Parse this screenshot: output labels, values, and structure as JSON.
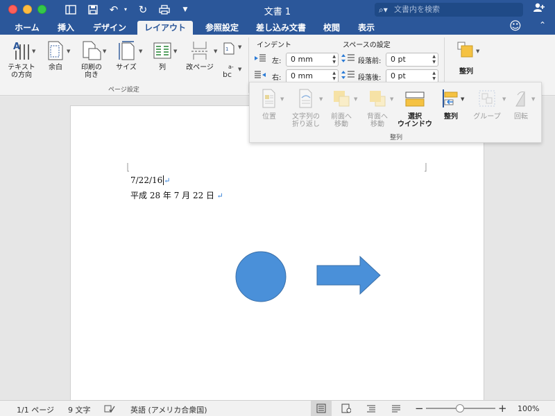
{
  "window": {
    "title": "文書 1"
  },
  "search": {
    "placeholder": "文書内を検索"
  },
  "tabs": [
    "ホーム",
    "挿入",
    "デザイン",
    "レイアウト",
    "参照設定",
    "差し込み文書",
    "校閲",
    "表示"
  ],
  "active_tab": "レイアウト",
  "ribbon": {
    "text_direction": "テキスト\nの方向",
    "margins": "余白",
    "orientation": "印刷の\n向き",
    "size": "サイズ",
    "columns": "列",
    "breaks": "改ページ",
    "page_setup_group": "ページ設定",
    "indent_title": "インデント",
    "spacing_title": "スペースの設定",
    "indent_left_label": "左:",
    "indent_right_label": "右:",
    "indent_left_value": "0 mm",
    "indent_right_value": "0 mm",
    "space_before_label": "段落前:",
    "space_after_label": "段落後:",
    "space_before_value": "0 pt",
    "space_after_value": "0 pt",
    "arrange": "整列"
  },
  "arrange_panel": {
    "position": "位置",
    "wrap_text": "文字列の\n折り返し",
    "bring_forward": "前面へ\n移動",
    "send_backward": "背面へ\n移動",
    "selection_pane": "選択\nウインドウ",
    "align": "整列",
    "group": "グループ",
    "rotate": "回転",
    "group_label": "整列"
  },
  "document": {
    "line1": "7/22/16",
    "line2": "平成 28 年 7 月 22 日"
  },
  "status": {
    "pages": "1/1 ページ",
    "words": "9 文字",
    "language": "英語 (アメリカ合衆国)",
    "zoom": "100%"
  },
  "colors": {
    "brand": "#2b579a",
    "shape_fill": "#4a90d9",
    "shape_stroke": "#3a6fa8"
  }
}
